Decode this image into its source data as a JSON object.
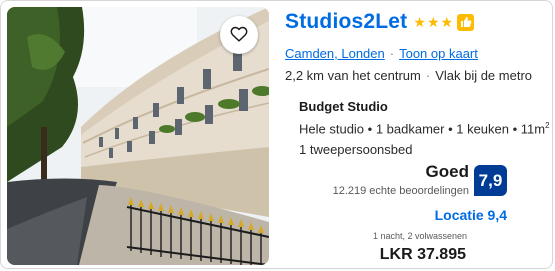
{
  "property": {
    "name": "Studios2Let",
    "star_count": 3,
    "stars": [
      "★",
      "★",
      "★"
    ],
    "location_link": "Camden, Londen",
    "map_link": "Toon op kaart",
    "distance": "2,2 km van het centrum",
    "metro": "Vlak bij de metro",
    "image_alt": "Curved terrace of white Georgian townhouses with black iron railings and gold spear tips"
  },
  "room": {
    "type": "Budget Studio",
    "details": "Hele studio • 1 badkamer • 1 keuken • 11m",
    "details_superscript": "2",
    "bed": "1 tweepersoonsbed"
  },
  "review": {
    "label": "Goed",
    "count_text": "12.219 echte beoordelingen",
    "score": "7,9",
    "location_score": "Locatie 9,4"
  },
  "pricing": {
    "stay": "1 nacht, 2 volwassenen",
    "price": "LKR 37.895"
  },
  "colors": {
    "accent": "#006ce4",
    "score_badge": "#003b95",
    "stars": "#febb02"
  },
  "icons": {
    "favorite": "heart-icon",
    "preferred": "thumbs-up-icon"
  }
}
